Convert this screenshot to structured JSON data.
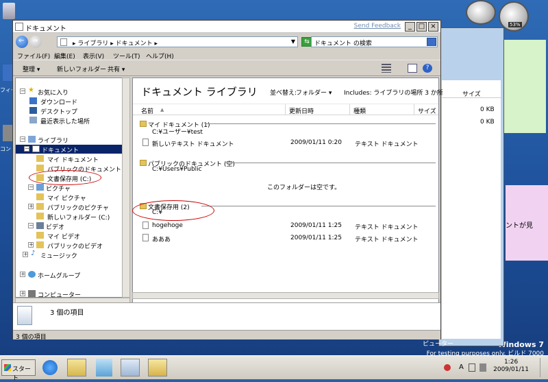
{
  "desktop": {
    "icon_labels": [
      "フィー",
      "コン"
    ],
    "watermark_brand": "Windows 7",
    "watermark_build": "For testing purposes only. ビルド 7000",
    "sticky_text": "ントが見",
    "gadget_text": "53%"
  },
  "back_window": {
    "size_header": "サイズ",
    "rows": [
      "0 KB",
      "0 KB"
    ],
    "status_text": "ピューター"
  },
  "window": {
    "title": "ドキュメント",
    "send_feedback": "Send Feedback",
    "controls": {
      "minimize": "_",
      "maximize": "□",
      "close": "×"
    },
    "address": "▸ ライブラリ ▸ ドキュメント ▸",
    "search_placeholder": "ドキュメント の検索",
    "menu": [
      "ファイル(F)",
      "編集(E)",
      "表示(V)",
      "ツール(T)",
      "ヘルプ(H)"
    ],
    "toolbar": {
      "organize": "整理 ▾",
      "new_folder": "新しいフォルダー",
      "share": "共有 ▾"
    }
  },
  "nav": {
    "items": [
      {
        "label": "お気に入り",
        "toggle": "−"
      },
      {
        "label": "ダウンロード"
      },
      {
        "label": "デスクトップ"
      },
      {
        "label": "最近表示した場所"
      },
      {
        "label": "ライブラリ",
        "toggle": "−"
      },
      {
        "label": "ドキュメント",
        "toggle": "−"
      },
      {
        "label": "マイ ドキュメント"
      },
      {
        "label": "パブリックのドキュメント"
      },
      {
        "label": "文書保存用 (C:)"
      },
      {
        "label": "ピクチャ",
        "toggle": "−"
      },
      {
        "label": "マイ ピクチャ"
      },
      {
        "label": "パブリックのピクチャ",
        "toggle": "+"
      },
      {
        "label": "新しいフォルダー (C:)"
      },
      {
        "label": "ビデオ",
        "toggle": "−"
      },
      {
        "label": "マイ ビデオ"
      },
      {
        "label": "パブリックのビデオ",
        "toggle": "+"
      },
      {
        "label": "ミュージック",
        "toggle": "+"
      },
      {
        "label": "ホームグループ",
        "toggle": "+"
      },
      {
        "label": "コンピューター",
        "toggle": "+"
      }
    ]
  },
  "content": {
    "library_title": "ドキュメント ライブラリ",
    "arrange_label": "並べ替え:",
    "arrange_value": "フォルダー ▾",
    "includes": "Includes:  ライブラリの場所 3 か所",
    "columns": [
      "名前",
      "更新日時",
      "種類",
      "サイズ"
    ],
    "groups": [
      {
        "title": "マイ ドキュメント (1)",
        "path": "C:¥ユーザー¥test"
      },
      {
        "title": "パブリックのドキュメント (空)",
        "path": "C:¥Users¥Public"
      },
      {
        "title": "文書保存用 (2)",
        "path": "C:¥"
      }
    ],
    "empty_text": "このフォルダーは空です。",
    "files": [
      {
        "name": "新しいテキスト ドキュメント",
        "date": "2009/01/11 0:20",
        "type": "テキスト ドキュメント"
      },
      {
        "name": "hogehoge",
        "date": "2009/01/11 1:25",
        "type": "テキスト ドキュメント"
      },
      {
        "name": "あああ",
        "date": "2009/01/11 1:25",
        "type": "テキスト ドキュメント"
      }
    ]
  },
  "details": {
    "count_text": "3 個の項目"
  },
  "status": {
    "text": "3 個の項目"
  },
  "taskbar": {
    "start_label": "スタート",
    "tray_label": "A",
    "time": "1:26",
    "date": "2009/01/11"
  }
}
